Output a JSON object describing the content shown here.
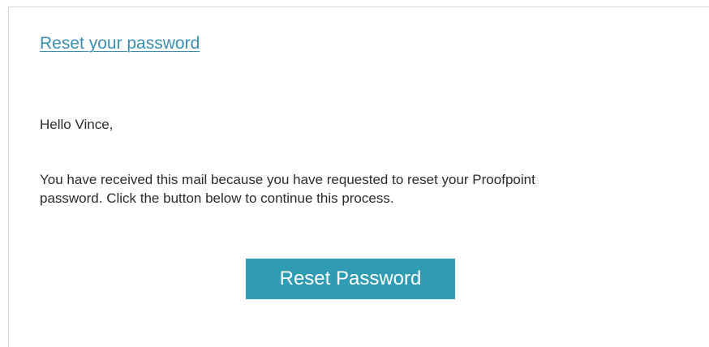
{
  "email": {
    "title_link": "Reset your password",
    "greeting": "Hello Vince,",
    "body_lines": [
      "You have received this mail because you have requested to reset your Proofpoint",
      "password. Click the button below to continue this process."
    ],
    "button_label": "Reset Password"
  },
  "colors": {
    "link": "#3b8fb0",
    "button_bg": "#2f9cb3",
    "button_text": "#ffffff",
    "body_text": "#2b2b2b",
    "border": "#d9d9d9"
  }
}
